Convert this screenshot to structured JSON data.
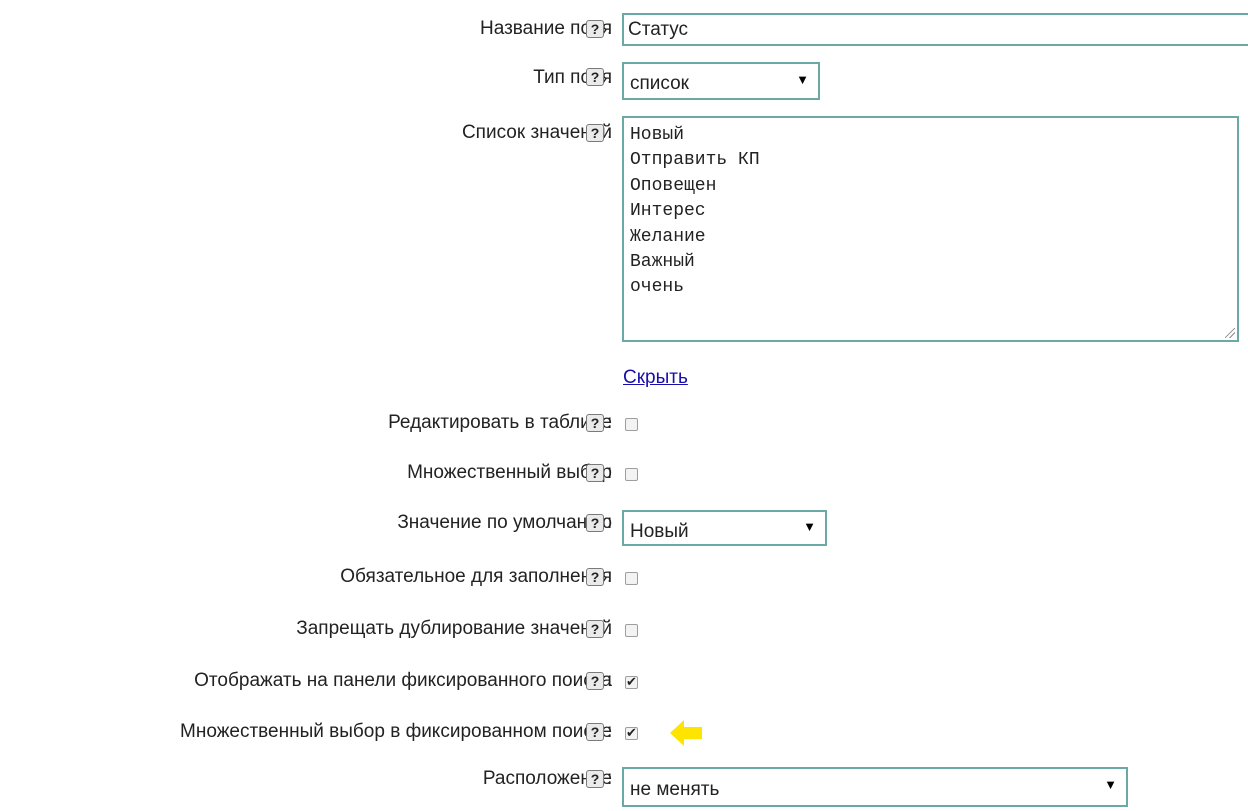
{
  "fields": {
    "field_name": {
      "label": "Название поля",
      "value": "Статус"
    },
    "field_type": {
      "label": "Тип поля",
      "value": "список"
    },
    "values_list": {
      "label": "Список значений",
      "lines": [
        "Новый",
        "Отправить КП",
        "Оповещен",
        "Интерес",
        "Желание",
        "Важный",
        "очень"
      ]
    },
    "hide_link": "Скрыть",
    "edit_in_table": {
      "label": "Редактировать в таблице",
      "checked": false
    },
    "multiple_choice": {
      "label": "Множественный выбор",
      "checked": false
    },
    "default_value": {
      "label": "Значение по умолчанию",
      "value": "Новый"
    },
    "required": {
      "label": "Обязательное для заполнения",
      "checked": false
    },
    "no_duplicates": {
      "label": "Запрещать дублирование значений",
      "checked": false
    },
    "show_in_fixed_search": {
      "label": "Отображать на панели фиксированного поиска",
      "checked": true
    },
    "multi_in_fixed_search": {
      "label": "Множественный выбор в фиксированном поиске",
      "checked": true
    },
    "location": {
      "label": "Расположение",
      "value": "не менять"
    }
  },
  "help_symbol": "?",
  "colon": ":",
  "select_arrow": "▼",
  "colors": {
    "input_border": "#6aa9a5",
    "link": "#1a0dab",
    "hint_arrow": "#ffe400"
  },
  "icons": {
    "help": "help-icon",
    "hint": "yellow-arrow-icon"
  }
}
